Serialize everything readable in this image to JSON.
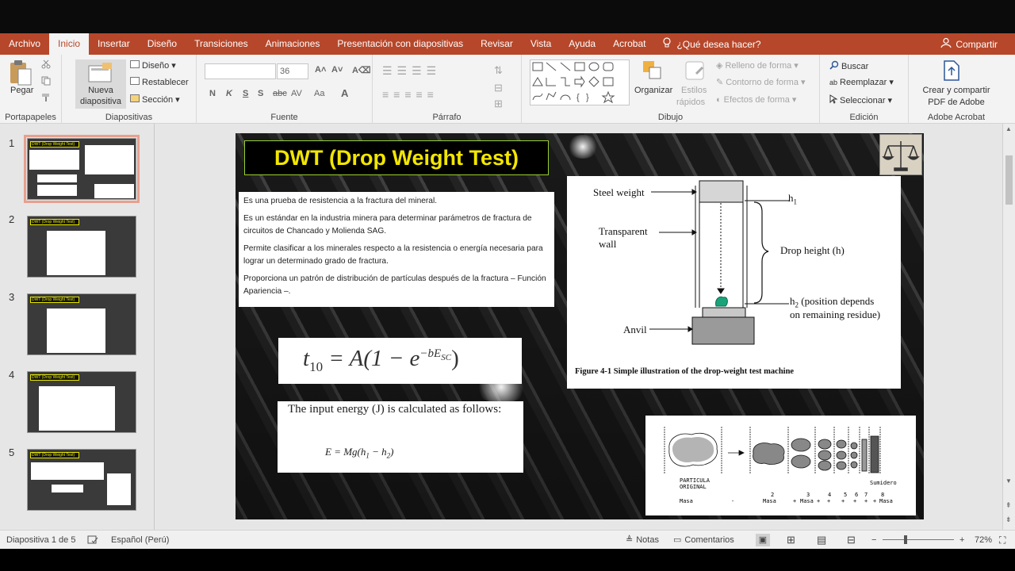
{
  "ribbon": {
    "tabs": [
      "Archivo",
      "Inicio",
      "Insertar",
      "Diseño",
      "Transiciones",
      "Animaciones",
      "Presentación con diapositivas",
      "Revisar",
      "Vista",
      "Ayuda",
      "Acrobat"
    ],
    "active_tab": "Inicio",
    "help": "¿Qué desea hacer?",
    "share": "Compartir",
    "groups": {
      "portapapeles": {
        "label": "Portapapeles",
        "paste": "Pegar"
      },
      "diapositivas": {
        "label": "Diapositivas",
        "new_slide_1": "Nueva",
        "new_slide_2": "diapositiva",
        "layout": "Diseño",
        "reset": "Restablecer",
        "section": "Sección"
      },
      "fuente": {
        "label": "Fuente",
        "font_name": "",
        "font_size": "36",
        "bold": "N",
        "italic": "K",
        "underline": "S",
        "shadow": "S",
        "strike": "abc",
        "spacing": "AV",
        "case": "Aa"
      },
      "parrafo": {
        "label": "Párrafo"
      },
      "dibujo": {
        "label": "Dibujo",
        "arrange": "Organizar",
        "quick_styles_1": "Estilos",
        "quick_styles_2": "rápidos",
        "fill": "Relleno de forma",
        "outline": "Contorno de forma",
        "effects": "Efectos de forma"
      },
      "edicion": {
        "label": "Edición",
        "find": "Buscar",
        "replace": "Reemplazar",
        "select": "Seleccionar"
      },
      "acrobat": {
        "label": "Adobe Acrobat",
        "create_1": "Crear y compartir",
        "create_2": "PDF de Adobe"
      }
    }
  },
  "thumbnails": [
    {
      "number": "1",
      "title": "DWT (Drop Weight Test)",
      "selected": true
    },
    {
      "number": "2",
      "title": "DWT (Drop Weight Test)",
      "selected": false
    },
    {
      "number": "3",
      "title": "DWT (Drop Weight Test)",
      "selected": false
    },
    {
      "number": "4",
      "title": "DWT (Drop Weight Test)",
      "selected": false
    },
    {
      "number": "5",
      "title": "DWT (Drop Weight Test)",
      "selected": false
    }
  ],
  "slide": {
    "title": "DWT (Drop Weight Test)",
    "bullets": [
      "Es una prueba de resistencia a la fractura del mineral.",
      "Es un estándar en la industria minera para determinar parámetros de fractura de circuitos de Chancado y Molienda SAG.",
      "Permite clasificar a los minerales respecto a la resistencia o energía necesaria para lograr un determinado grado de fractura.",
      "Proporciona  un patrón de distribución de partículas después de la fractura – Función Apariencia –."
    ],
    "formula1": {
      "lhs": "t",
      "lhs_sub": "10",
      "rhs": "= A(1 − e",
      "exp": "−bE",
      "exp_sub": "SC",
      "close": ")"
    },
    "energy_text": "The input energy (J) is calculated as follows:",
    "formula2": {
      "text": "E = Mg(h",
      "s1": "1",
      "mid": " − h",
      "s2": "2",
      "close": ")"
    },
    "figure1": {
      "steel_weight": "Steel weight",
      "transparent": "Transparent",
      "wall": "wall",
      "h1": "h",
      "h1_sub": "1",
      "drop_height": "Drop height (h)",
      "h2": "h",
      "h2_sub": "2",
      "h2_text_1": " (position depends",
      "h2_text_2": "on remaining residue)",
      "anvil": "Anvil",
      "caption": "Figure 4-1 Simple illustration of the drop-weight test machine"
    },
    "figure2": {
      "particle_1": "PARTICULA",
      "particle_2": "ORIGINAL",
      "sump": "Sumidero",
      "masa": "Masa",
      "dash": "-",
      "n2": "2",
      "n3": "3",
      "n4": "4",
      "n5": "5",
      "n6": "6",
      "n7": "7",
      "n8": "8",
      "plus": "+"
    }
  },
  "status": {
    "slide_info": "Diapositiva 1 de 5",
    "language": "Español (Perú)",
    "notes": "Notas",
    "comments": "Comentarios",
    "zoom": "72%",
    "zoom_level": 0.72
  }
}
